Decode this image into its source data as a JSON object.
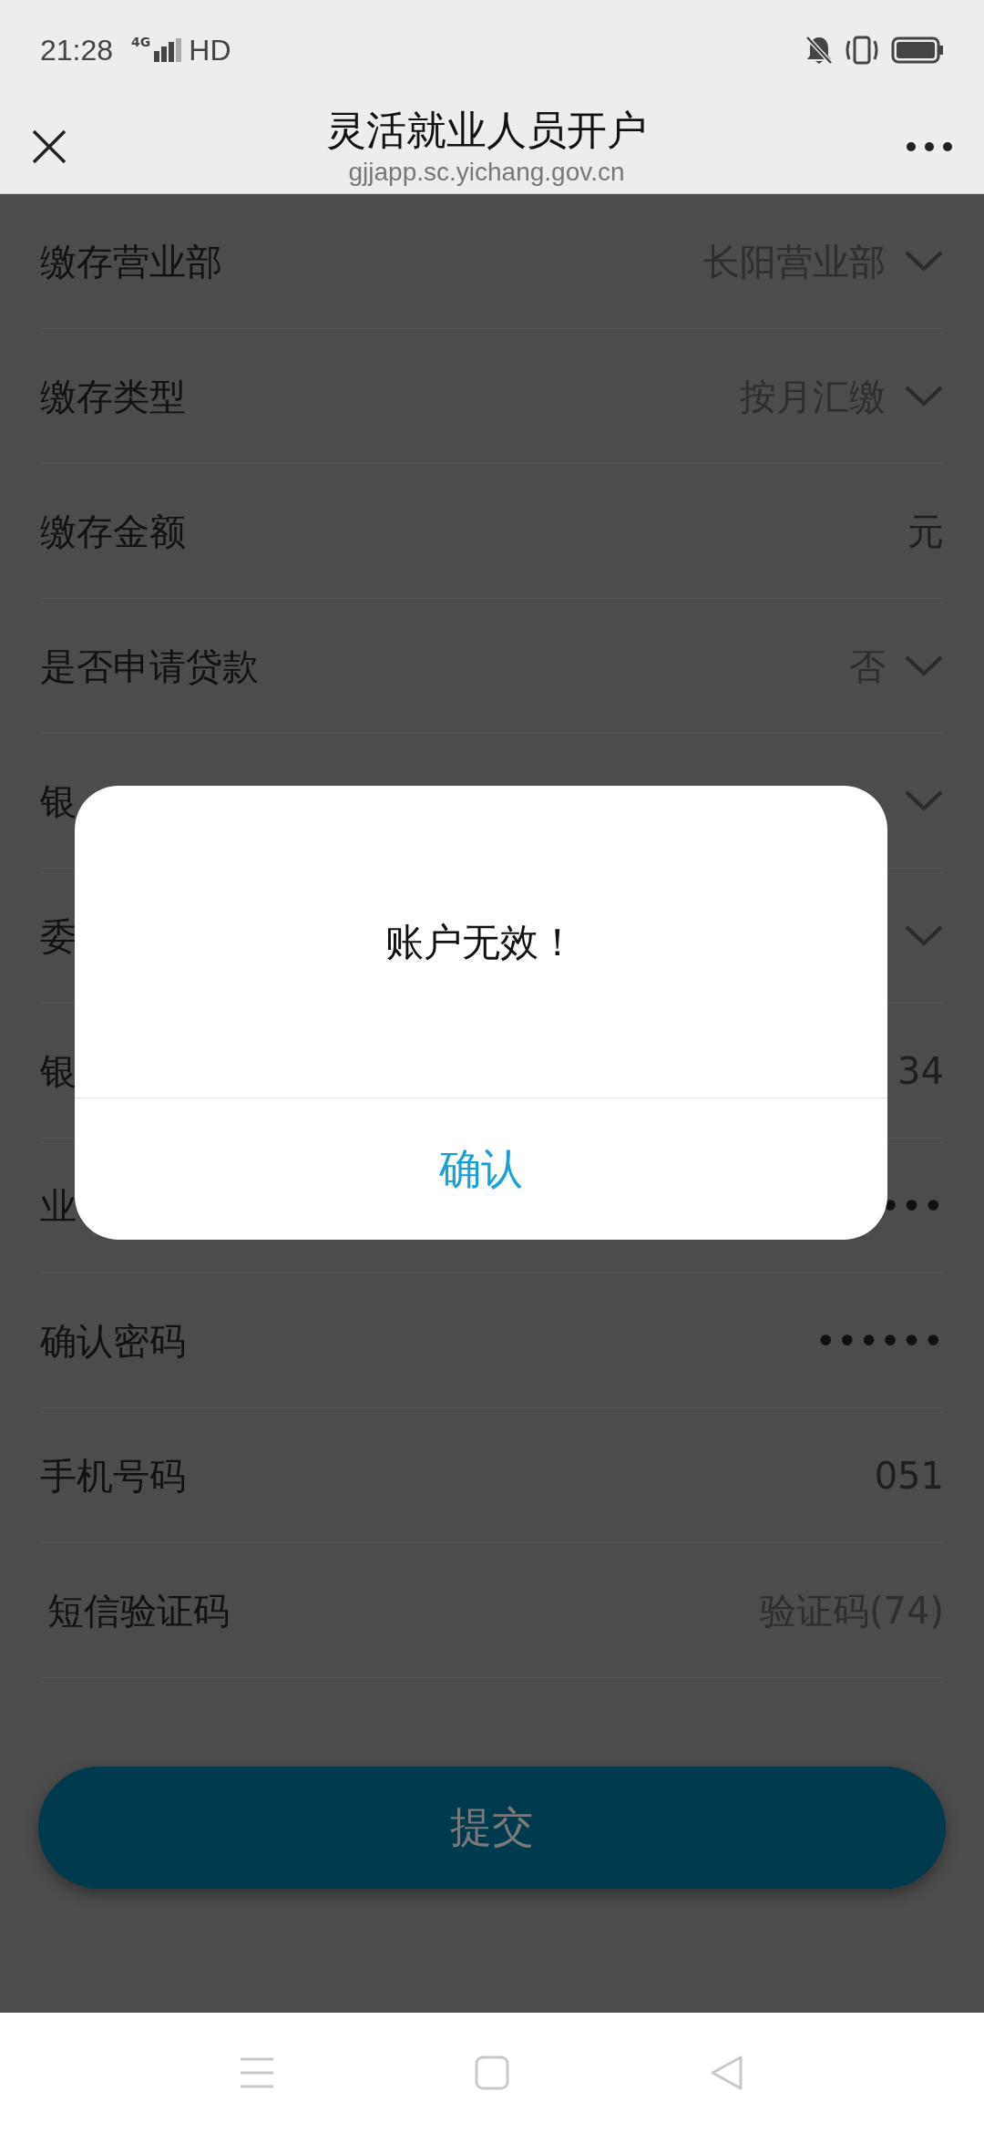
{
  "status_bar": {
    "time": "21:28",
    "network": "4G",
    "hd": "HD"
  },
  "header": {
    "title": "灵活就业人员开户",
    "url": "gjjapp.sc.yichang.gov.cn"
  },
  "form": {
    "rows": [
      {
        "label": "缴存营业部",
        "value": "长阳营业部",
        "kind": "select"
      },
      {
        "label": "缴存类型",
        "value": "按月汇缴",
        "kind": "select"
      },
      {
        "label": "缴存金额",
        "value": "元",
        "kind": "text"
      },
      {
        "label": "是否申请贷款",
        "value": "否",
        "kind": "select"
      },
      {
        "label": "银",
        "kind": "select"
      },
      {
        "label": "委",
        "kind": "select"
      },
      {
        "label": "银",
        "value": "34",
        "kind": "text"
      },
      {
        "label": "业",
        "value": "•••",
        "kind": "password"
      },
      {
        "label": "确认密码",
        "value": "••••••",
        "kind": "password"
      },
      {
        "label": "手机号码",
        "value": "051",
        "kind": "text"
      },
      {
        "label": "短信验证码",
        "value": "验证码(74)",
        "kind": "sms"
      }
    ]
  },
  "submit_button": "提交",
  "dialog": {
    "message": "账户无效！",
    "confirm": "确认"
  }
}
